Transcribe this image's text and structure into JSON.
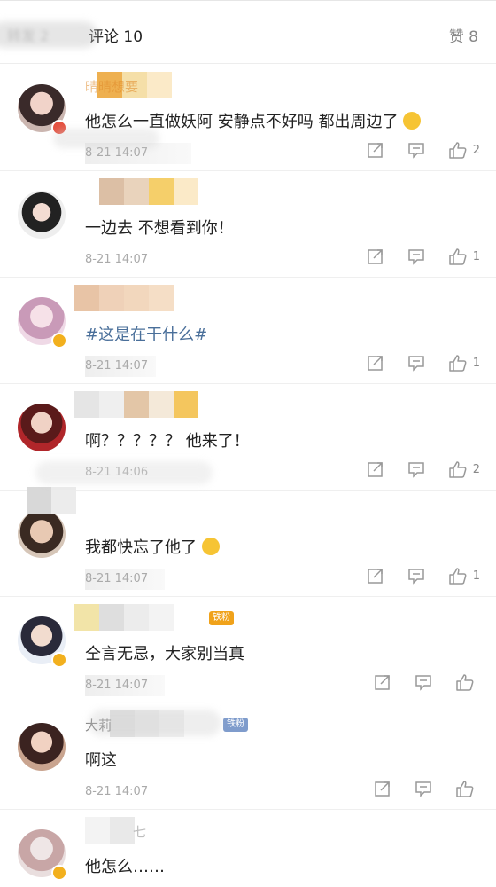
{
  "header": {
    "blurred_tab": "转发 2",
    "comments_tab": "评论 10",
    "likes_tab": "赞 8"
  },
  "comments": [
    {
      "name": "晴晴想要",
      "text": "他怎么一直做妖阿 安静点不好吗 都出周边了",
      "time": "8-21 14:07",
      "likes": "2",
      "emoji": true
    },
    {
      "name": "",
      "text": "一边去 不想看到你！",
      "time": "8-21 14:07",
      "likes": "1"
    },
    {
      "name": "",
      "text": "#这是在干什么#",
      "time": "8-21 14:07",
      "likes": "1",
      "topic": true
    },
    {
      "name": "",
      "text": "啊？？？？？ 他来了！",
      "time": "8-21 14:06",
      "likes": "2"
    },
    {
      "name": "",
      "text": "我都快忘了他了",
      "time": "8-21 14:07",
      "likes": "1",
      "emoji": true
    },
    {
      "name": "",
      "text": "仝言无忌，大家别当真",
      "time": "8-21 14:07",
      "likes": "",
      "fan_badge": "铁粉"
    },
    {
      "name": "大莉",
      "text": "啊这",
      "time": "8-21 14:07",
      "likes": "",
      "fan_badge": "铁粉"
    },
    {
      "name": "七",
      "text": "他怎么……",
      "time": "",
      "likes": ""
    }
  ],
  "icons": {
    "forward": "share-icon",
    "reply": "comment-icon",
    "like": "thumbs-up-icon"
  },
  "colors": {
    "accent_orange": "#e08b2a",
    "topic_blue": "#4a6f9a",
    "verified_gold": "#f2b01e",
    "badge_red": "#e5503f"
  }
}
